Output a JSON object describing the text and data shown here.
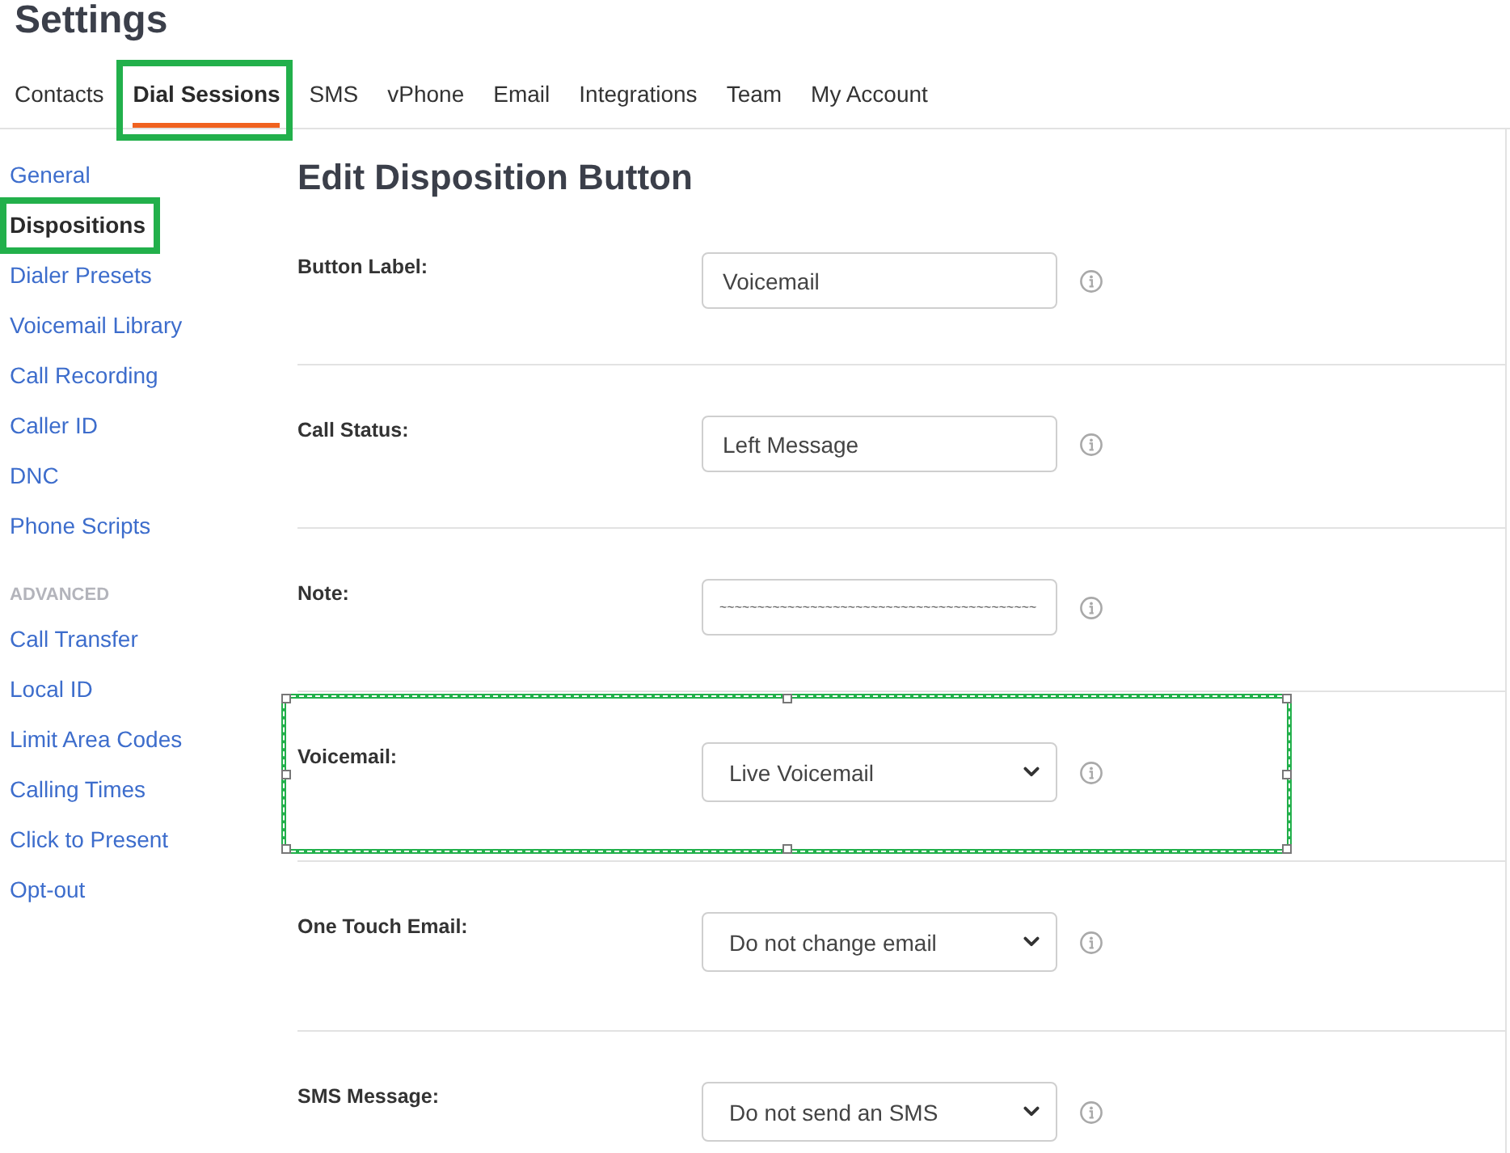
{
  "page": {
    "title": "Settings"
  },
  "tabs": [
    {
      "label": "Contacts",
      "selected": false,
      "highlighted": false
    },
    {
      "label": "Dial Sessions",
      "selected": true,
      "highlighted": true
    },
    {
      "label": "SMS",
      "selected": false,
      "highlighted": false
    },
    {
      "label": "vPhone",
      "selected": false,
      "highlighted": false
    },
    {
      "label": "Email",
      "selected": false,
      "highlighted": false
    },
    {
      "label": "Integrations",
      "selected": false,
      "highlighted": false
    },
    {
      "label": "Team",
      "selected": false,
      "highlighted": false
    },
    {
      "label": "My Account",
      "selected": false,
      "highlighted": false
    }
  ],
  "sidebar": {
    "groups": [
      {
        "items": [
          {
            "label": "General",
            "selected": false,
            "highlighted": false
          },
          {
            "label": "Dispositions",
            "selected": true,
            "highlighted": true
          },
          {
            "label": "Dialer Presets",
            "selected": false,
            "highlighted": false
          },
          {
            "label": "Voicemail Library",
            "selected": false,
            "highlighted": false
          },
          {
            "label": "Call Recording",
            "selected": false,
            "highlighted": false
          },
          {
            "label": "Caller ID",
            "selected": false,
            "highlighted": false
          },
          {
            "label": "DNC",
            "selected": false,
            "highlighted": false
          },
          {
            "label": "Phone Scripts",
            "selected": false,
            "highlighted": false
          }
        ]
      },
      {
        "header": "ADVANCED",
        "items": [
          {
            "label": "Call Transfer",
            "selected": false,
            "highlighted": false
          },
          {
            "label": "Local ID",
            "selected": false,
            "highlighted": false
          },
          {
            "label": "Limit Area Codes",
            "selected": false,
            "highlighted": false
          },
          {
            "label": "Calling Times",
            "selected": false,
            "highlighted": false
          },
          {
            "label": "Click to Present",
            "selected": false,
            "highlighted": false
          },
          {
            "label": "Opt-out",
            "selected": false,
            "highlighted": false
          }
        ]
      }
    ]
  },
  "form": {
    "title": "Edit Disposition Button",
    "rows": [
      {
        "label": "Button Label:",
        "kind": "text",
        "value": "Voicemail",
        "highlighted": false
      },
      {
        "label": "Call Status:",
        "kind": "text",
        "value": "Left Message",
        "highlighted": false
      },
      {
        "label": "Note:",
        "kind": "note",
        "value": "~~~~~~~~~~~~~~~~~~~~~~~~~~~~~~~~~~~~~~~~~~",
        "highlighted": false
      },
      {
        "label": "Voicemail:",
        "kind": "select",
        "value": "Live Voicemail",
        "highlighted": true
      },
      {
        "label": "One Touch Email:",
        "kind": "select",
        "value": "Do not change email",
        "highlighted": false
      },
      {
        "label": "SMS Message:",
        "kind": "select",
        "value": "Do not send an SMS",
        "highlighted": false
      }
    ]
  }
}
